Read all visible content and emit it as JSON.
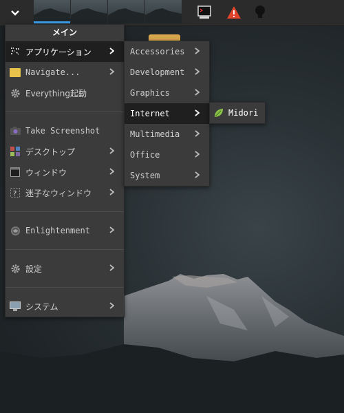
{
  "main_menu": {
    "title": "メイン",
    "items": [
      {
        "label": "アプリケーション",
        "icon": "applications-icon",
        "submenu": true,
        "selected": true
      },
      {
        "label": "Navigate...",
        "icon": "folder-icon",
        "submenu": true
      },
      {
        "label": "Everything起動",
        "icon": "gear-icon",
        "submenu": false
      },
      {
        "label": "Take Screenshot",
        "icon": "camera-icon",
        "submenu": false
      },
      {
        "label": "デスクトップ",
        "icon": "desktop-icon",
        "submenu": true
      },
      {
        "label": "ウィンドウ",
        "icon": "window-icon",
        "submenu": true
      },
      {
        "label": "迷子なウィンドウ",
        "icon": "lost-window-icon",
        "submenu": true
      },
      {
        "label": "Enlightenment",
        "icon": "enlightenment-icon",
        "submenu": true
      },
      {
        "label": "設定",
        "icon": "settings-gear-icon",
        "submenu": true
      },
      {
        "label": "システム",
        "icon": "monitor-icon",
        "submenu": true
      }
    ]
  },
  "applications_menu": {
    "items": [
      {
        "label": "Accessories"
      },
      {
        "label": "Development"
      },
      {
        "label": "Graphics"
      },
      {
        "label": "Internet",
        "selected": true
      },
      {
        "label": "Multimedia"
      },
      {
        "label": "Office"
      },
      {
        "label": "System"
      }
    ]
  },
  "internet_menu": {
    "items": [
      {
        "label": "Midori",
        "icon": "midori-leaf-icon"
      }
    ]
  },
  "shelf": {
    "start_icon": "chevron-down-icon",
    "desktops": 4,
    "active_desktop": 1,
    "tray_icons": [
      "terminal-icon",
      "warning-icon",
      "lightbulb-icon"
    ]
  },
  "colors": {
    "accent": "#3aa1f0",
    "menu_bg": "#3b3b3b",
    "selected_bg": "#1f1f1f",
    "warning": "#e0452b",
    "midori": "#8bc34a"
  }
}
